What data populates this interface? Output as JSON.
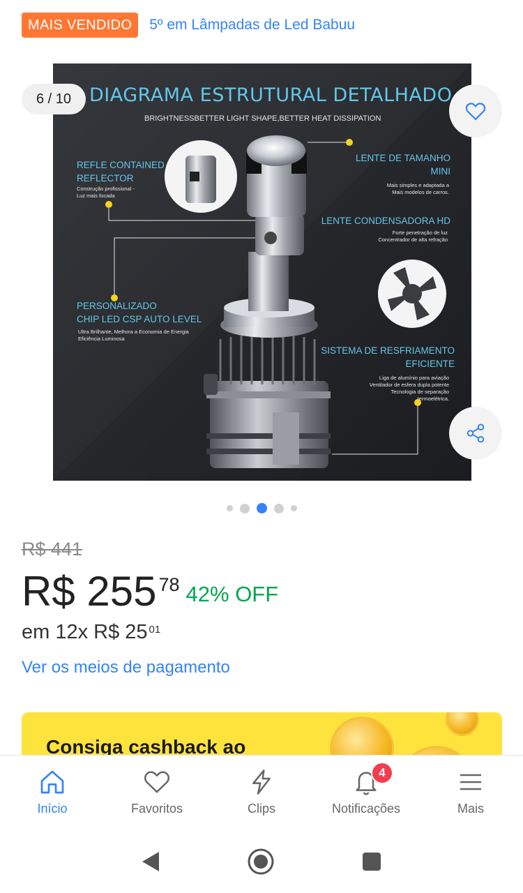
{
  "header": {
    "badge": "MAIS VENDIDO",
    "rank_text": "5º em Lâmpadas de Led Babuu"
  },
  "gallery": {
    "counter": "6 / 10",
    "dots": [
      {
        "state": "small"
      },
      {
        "state": "normal"
      },
      {
        "state": "active"
      },
      {
        "state": "normal"
      },
      {
        "state": "small"
      }
    ],
    "image": {
      "title": "DIAGRAMA ESTRUTURAL DETALHADO",
      "subtitle": "BRIGHTNESSBETTER LIGHT SHAPE,BETTER HEAT DISSIPATION",
      "callouts": {
        "reflector_title_1": "REFLE CONTAINED",
        "reflector_title_2": "REFLECTOR",
        "reflector_note_1": "Construção profissional -",
        "reflector_note_2": "Luz mais focada",
        "lens_title_1": "LENTE DE TAMANHO",
        "lens_title_2": "MINI",
        "lens_note_1": "Mais simples e adaptada a",
        "lens_note_2": "Mais modelos de carros.",
        "condenser_title": "LENTE CONDENSADORA HD",
        "condenser_note_1": "Forte penetração de luz",
        "condenser_note_2": "Concentrador de alta refração",
        "chip_title_1": "PERSONALIZADO",
        "chip_title_2": "CHIP LED CSP AUTO LEVEL",
        "chip_note_1": "Ultra Brilhante, Melhora a Economia de Energia",
        "chip_note_2": "Eficiência Luminosa",
        "cooling_title_1": "SISTEMA DE RESFRIAMENTO",
        "cooling_title_2": "EFICIENTE",
        "cooling_note_1": "Liga de alumínio para aviação",
        "cooling_note_2": "Ventilador de esfera dupla potente",
        "cooling_note_3": "Tecnologia de separação",
        "cooling_note_4": "termoelétrica."
      }
    },
    "fav_icon": "heart-icon",
    "share_icon": "share-icon"
  },
  "price": {
    "old": "R$ 441",
    "main": "R$ 255",
    "cents": "78",
    "discount": "42% OFF",
    "installments_prefix": "em 12x R$ 25",
    "installments_cents": "01",
    "payment_link": "Ver os meios de pagamento"
  },
  "cashback": {
    "text": "Consiga cashback ao"
  },
  "bottom_nav": {
    "items": [
      {
        "label": "Início",
        "icon": "home-icon"
      },
      {
        "label": "Favoritos",
        "icon": "heart-icon"
      },
      {
        "label": "Clips",
        "icon": "bolt-icon"
      },
      {
        "label": "Notificações",
        "icon": "bell-icon",
        "badge": "4"
      },
      {
        "label": "Mais",
        "icon": "menu-icon"
      }
    ]
  },
  "colors": {
    "accent": "#3483fa",
    "badge_orange": "#ff7733",
    "discount_green": "#00a650",
    "cashback_yellow": "#ffe33d",
    "notif_red": "#f23d4f"
  }
}
